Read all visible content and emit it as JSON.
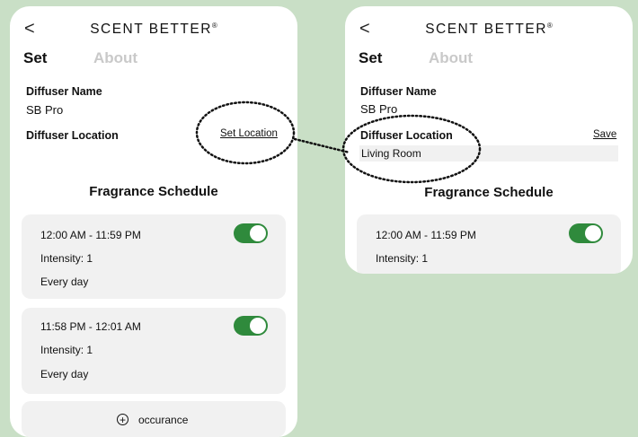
{
  "header": {
    "back_symbol": "<",
    "brand": "SCENT BETTER",
    "brand_mark": "®"
  },
  "tabs": [
    {
      "label": "Set",
      "active": true
    },
    {
      "label": "About",
      "active": false
    }
  ],
  "left_screen": {
    "diffuser_name_label": "Diffuser Name",
    "diffuser_name_value": "SB Pro",
    "diffuser_location_label": "Diffuser Location",
    "set_location_link": "Set Location",
    "schedule_title": "Fragrance Schedule",
    "schedules": [
      {
        "time": "12:00 AM - 11:59 PM",
        "intensity": "Intensity: 1",
        "days": "Every day",
        "enabled": true
      },
      {
        "time": "11:58 PM - 12:01 AM",
        "intensity": "Intensity: 1",
        "days": "Every day",
        "enabled": true
      }
    ],
    "add_label": "occurance",
    "add_icon": "+"
  },
  "right_screen": {
    "diffuser_name_label": "Diffuser Name",
    "diffuser_name_value": "SB Pro",
    "diffuser_location_label": "Diffuser Location",
    "save_link": "Save",
    "location_value": "Living Room",
    "schedule_title": "Fragrance Schedule",
    "schedules": [
      {
        "time": "12:00 AM - 11:59 PM",
        "intensity": "Intensity: 1",
        "enabled": true
      }
    ]
  },
  "colors": {
    "background": "#c9dfc6",
    "toggle_on": "#2f8a3c",
    "card_bg": "#f1f1f1",
    "inactive_tab": "#c9c9c9"
  }
}
